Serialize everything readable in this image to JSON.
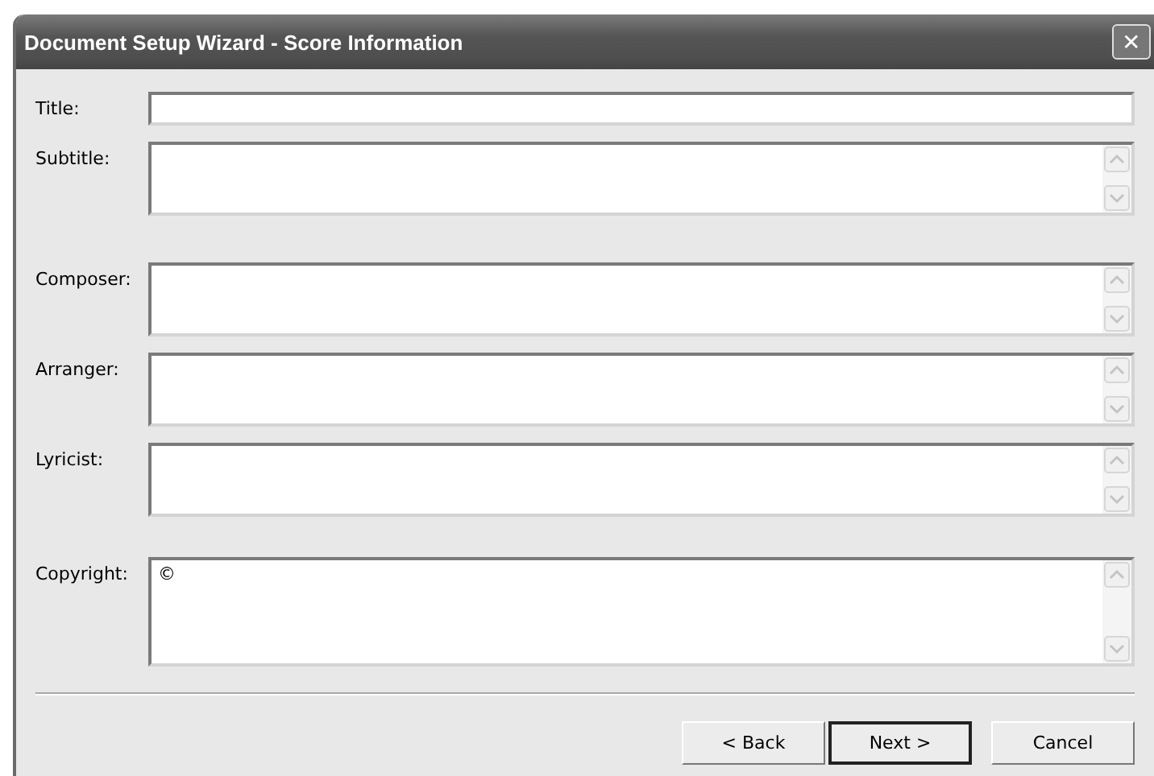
{
  "window": {
    "title": "Document Setup Wizard - Score Information",
    "close": "✕"
  },
  "groups": [
    {
      "fields": [
        {
          "label": "Title:",
          "kind": "single"
        },
        {
          "label": "Subtitle:",
          "kind": "multi"
        }
      ]
    },
    {
      "fields": [
        {
          "label": "Composer:",
          "kind": "multi"
        },
        {
          "label": "Arranger:",
          "kind": "multi"
        },
        {
          "label": "Lyricist:",
          "kind": "multi"
        }
      ]
    },
    {
      "fields": [
        {
          "label": "Copyright:",
          "kind": "tall",
          "value": "©"
        }
      ]
    }
  ],
  "buttons": [
    {
      "label": "< Back",
      "default": false
    },
    {
      "label": "Next >",
      "default": true
    },
    {
      "label": "Cancel",
      "default": false
    }
  ]
}
